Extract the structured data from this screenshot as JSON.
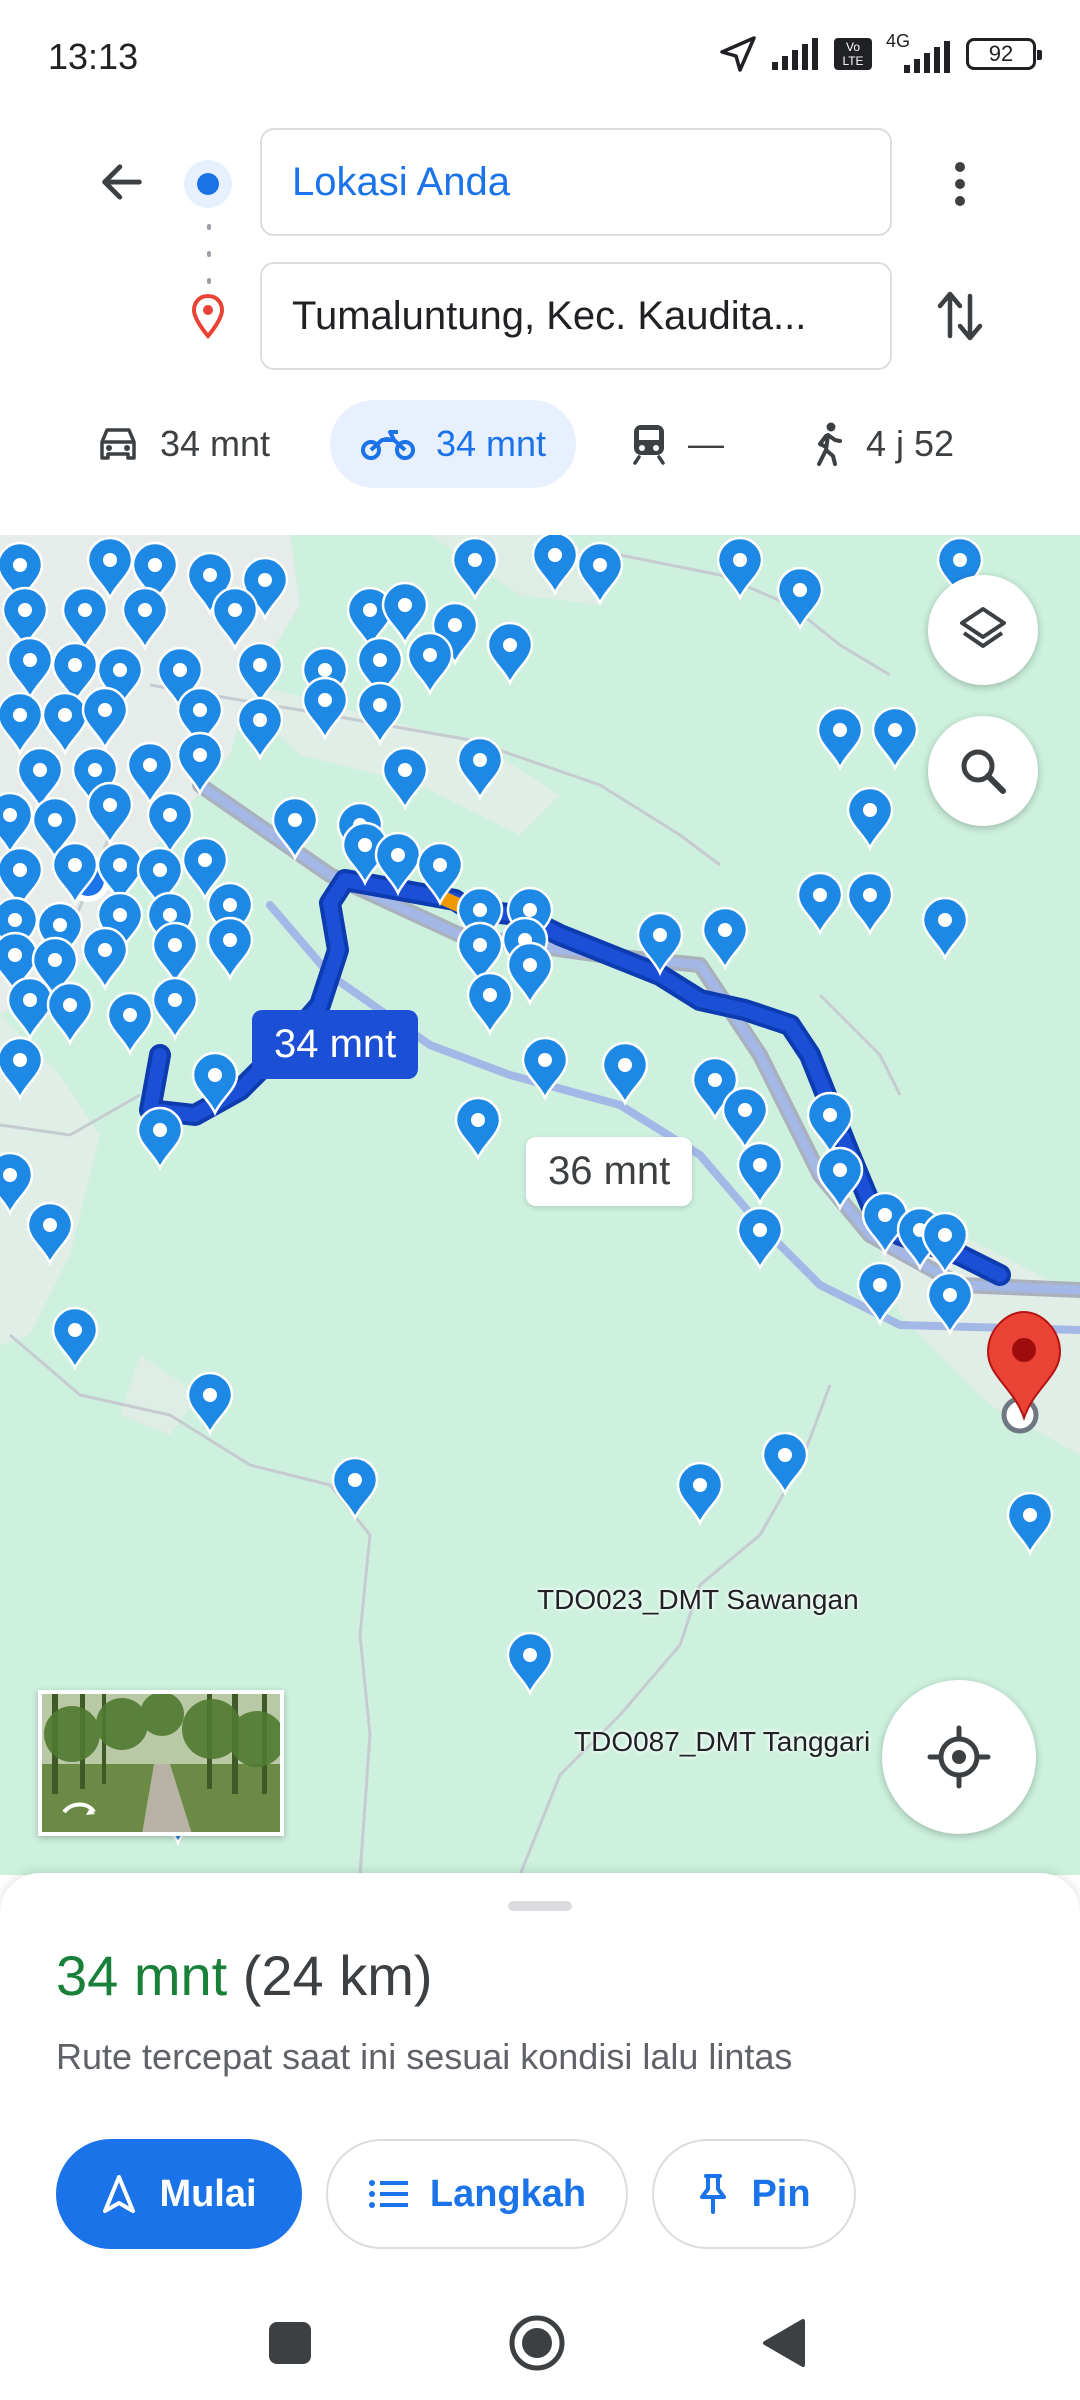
{
  "status_bar": {
    "time": "13:13",
    "network": "4G",
    "volte": "Vo LTE",
    "battery": "92",
    "icons": [
      "location-arrow-icon",
      "signal-icon",
      "volte-icon",
      "signal-4g-icon",
      "battery-icon"
    ]
  },
  "directions": {
    "origin": "Lokasi Anda",
    "destination": "Tumaluntung, Kec. Kaudita...",
    "icons": [
      "arrow-back-icon",
      "origin-dot-icon",
      "destination-pin-icon",
      "more-vert-icon",
      "swap-icon"
    ]
  },
  "travel_modes": [
    {
      "mode": "car",
      "icon": "car-icon",
      "label": "34 mnt",
      "selected": false
    },
    {
      "mode": "motorcycle",
      "icon": "motorcycle-icon",
      "label": "34 mnt",
      "selected": true
    },
    {
      "mode": "transit",
      "icon": "train-icon",
      "label": "—",
      "selected": false
    },
    {
      "mode": "walk",
      "icon": "walk-icon",
      "label": "4 j 52",
      "selected": false
    }
  ],
  "map": {
    "primary_route_time": "34 mnt",
    "alternate_route_time": "36 mnt",
    "place_labels": [
      "TDO023_DMT Sawangan",
      "TDO087_DMT Tanggari"
    ],
    "controls": [
      "layers-icon",
      "search-icon",
      "my-location-icon",
      "street-view-thumbnail"
    ],
    "colors": {
      "land": "#cdf1de",
      "primary_route": "#1a4fd6",
      "alternate_route": "#a4b8e8",
      "pin": "#1e88e5",
      "destination_pin": "#ea4335"
    }
  },
  "sheet": {
    "duration": "34 mnt",
    "distance": "(24 km)",
    "description": "Rute tercepat saat ini sesuai kondisi lalu lintas",
    "buttons": {
      "start": "Mulai",
      "steps": "Langkah",
      "pin": "Pin"
    },
    "colors": {
      "duration": "#188038",
      "accent": "#1a73e8"
    }
  },
  "nav_bar": {
    "icons": [
      "recents-square-icon",
      "home-circle-icon",
      "back-triangle-icon"
    ]
  }
}
